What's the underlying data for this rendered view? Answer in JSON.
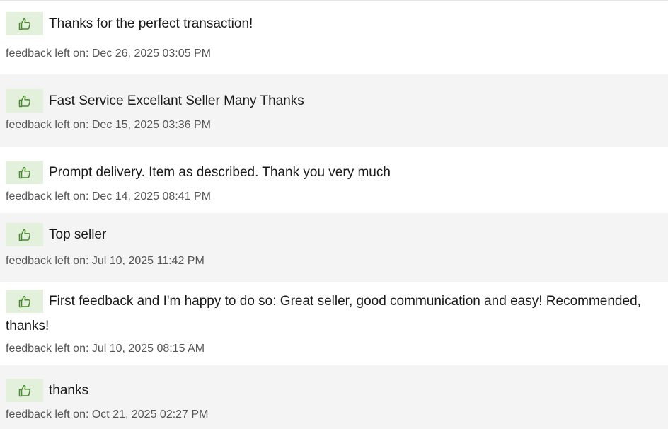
{
  "feedback": [
    {
      "comment": "Thanks for the perfect transaction!",
      "date": "feedback left on: Dec 26, 2025 03:05 PM",
      "rating_icon": "thumbs-up-icon"
    },
    {
      "comment": "Fast Service Excellant Seller Many Thanks",
      "date": "feedback left on: Dec 15, 2025 03:36 PM",
      "rating_icon": "thumbs-up-icon"
    },
    {
      "comment": "Prompt delivery. Item as described. Thank you very much",
      "date": "feedback left on: Dec 14, 2025 08:41 PM",
      "rating_icon": "thumbs-up-icon"
    },
    {
      "comment": "Top seller",
      "date": "feedback left on: Jul 10, 2025 11:42 PM",
      "rating_icon": "thumbs-up-icon"
    },
    {
      "comment": "First feedback and I'm happy to do so: Great seller, good communication and easy! Recommended, thanks!",
      "date": "feedback left on: Jul 10, 2025 08:15 AM",
      "rating_icon": "thumbs-up-icon"
    },
    {
      "comment": "thanks",
      "date": "feedback left on: Oct 21, 2025 02:27 PM",
      "rating_icon": "thumbs-up-icon"
    }
  ],
  "colors": {
    "positive_badge": "#e3f0dc",
    "thumb_icon": "#4a8a2e",
    "row_shade": "#f4f4f4"
  }
}
